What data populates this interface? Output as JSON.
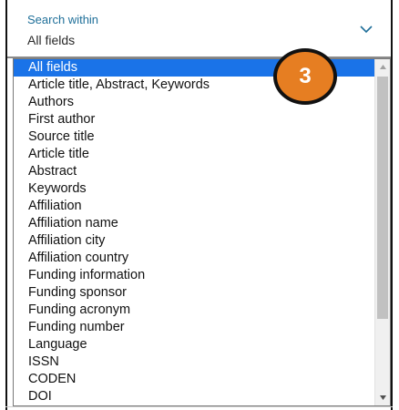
{
  "search_within": {
    "label": "Search within",
    "value": "All fields",
    "chevron_icon": "chevron-down-icon"
  },
  "dropdown": {
    "selected_index": 0,
    "options": [
      "All fields",
      "Article title, Abstract, Keywords",
      "Authors",
      "First author",
      "Source title",
      "Article title",
      "Abstract",
      "Keywords",
      "Affiliation",
      "Affiliation name",
      "Affiliation city",
      "Affiliation country",
      "Funding information",
      "Funding sponsor",
      "Funding acronym",
      "Funding number",
      "Language",
      "ISSN",
      "CODEN",
      "DOI"
    ]
  },
  "annotation": {
    "step_number": "3",
    "badge_color": "#e67e22"
  },
  "colors": {
    "label": "#1f6f99",
    "selected_bg": "#1a73e8",
    "selected_text": "#ffffff"
  }
}
